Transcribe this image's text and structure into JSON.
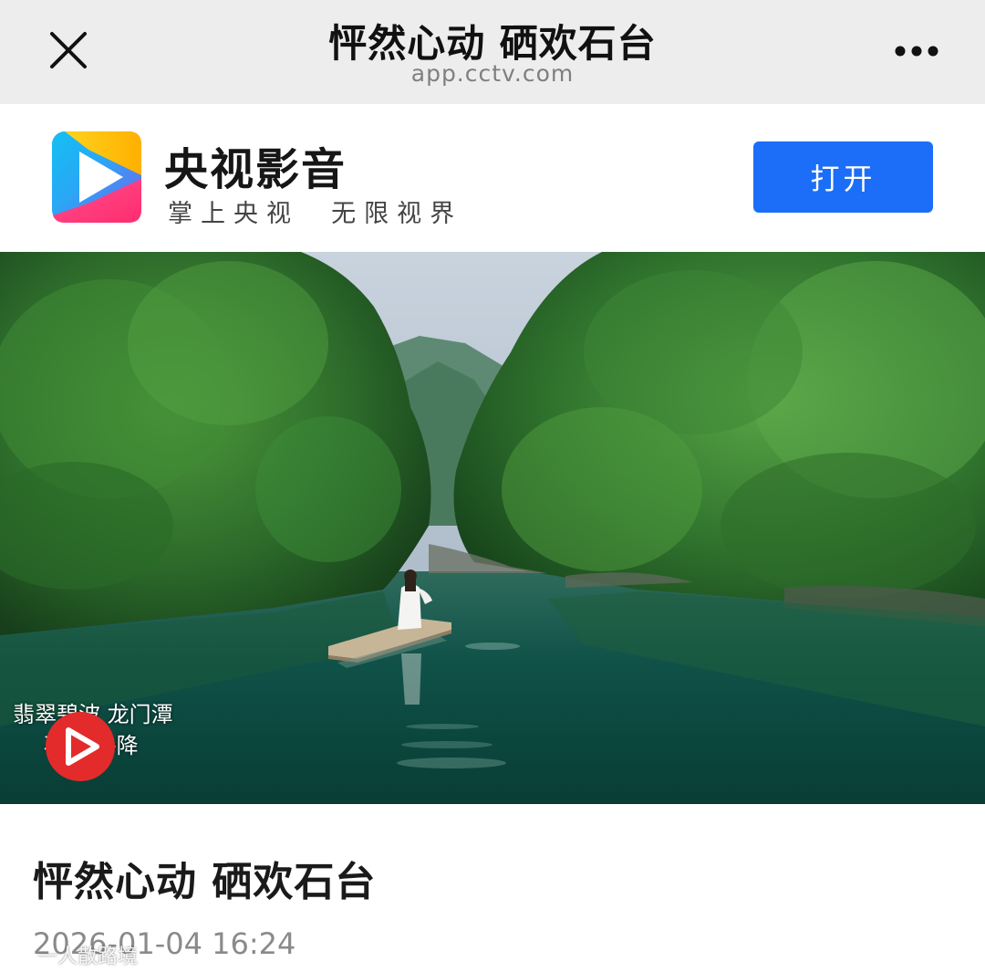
{
  "topbar": {
    "title": "怦然心动 硒欢石台",
    "domain": "app.cctv.com",
    "close_icon": "close-icon",
    "more_icon": "more-dots-icon"
  },
  "app_banner": {
    "name": "央视影音",
    "slogan": "掌上央视  无限视界",
    "open_label": "打开",
    "logo_icon": "cctv-video-logo-icon",
    "accent_color": "#1c6ef8"
  },
  "video": {
    "caption_line1": "翡翠碧波 龙门潭",
    "caption_line2": "石台  牛降",
    "logo_icon": "video-channel-logo-icon"
  },
  "article": {
    "title": "怦然心动 硒欢石台",
    "date": "2026-01-04 16:24"
  },
  "watermark": {
    "text": "一人散路境",
    "icon": "weibo-watermark-icon"
  }
}
